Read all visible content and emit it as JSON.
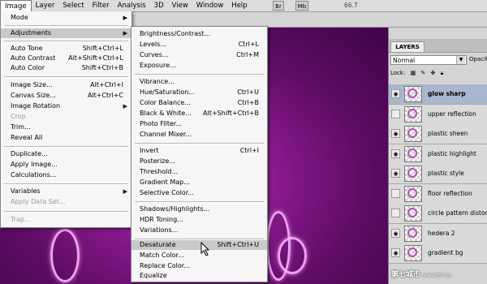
{
  "menubar": {
    "items": [
      "Image",
      "Layer",
      "Select",
      "Filter",
      "Analysis",
      "3D",
      "View",
      "Window",
      "Help"
    ],
    "buttons": [
      "Br",
      "Mb"
    ],
    "zoom": "66.7"
  },
  "image_menu": {
    "items": [
      {
        "label": "Mode",
        "shortcut": "",
        "submenu": true
      },
      {
        "label": "Adjustments",
        "shortcut": "",
        "submenu": true
      },
      {
        "label": "Auto Tone",
        "shortcut": "Shift+Ctrl+L"
      },
      {
        "label": "Auto Contrast",
        "shortcut": "Alt+Shift+Ctrl+L"
      },
      {
        "label": "Auto Color",
        "shortcut": "Shift+Ctrl+B"
      },
      {
        "label": "Image Size...",
        "shortcut": "Alt+Ctrl+I"
      },
      {
        "label": "Canvas Size...",
        "shortcut": "Alt+Ctrl+C"
      },
      {
        "label": "Image Rotation",
        "shortcut": "",
        "submenu": true
      },
      {
        "label": "Crop",
        "shortcut": "",
        "disabled": true
      },
      {
        "label": "Trim...",
        "shortcut": ""
      },
      {
        "label": "Reveal All",
        "shortcut": ""
      },
      {
        "label": "Duplicate...",
        "shortcut": ""
      },
      {
        "label": "Apply Image...",
        "shortcut": ""
      },
      {
        "label": "Calculations...",
        "shortcut": ""
      },
      {
        "label": "Variables",
        "shortcut": "",
        "submenu": true
      },
      {
        "label": "Apply Data Set...",
        "shortcut": "",
        "disabled": true
      },
      {
        "label": "Trap...",
        "shortcut": "",
        "disabled": true
      }
    ]
  },
  "adjustments_menu": {
    "items": [
      {
        "label": "Brightness/Contrast...",
        "shortcut": ""
      },
      {
        "label": "Levels...",
        "shortcut": "Ctrl+L"
      },
      {
        "label": "Curves...",
        "shortcut": "Ctrl+M"
      },
      {
        "label": "Exposure...",
        "shortcut": ""
      },
      {
        "label": "Vibrance...",
        "shortcut": ""
      },
      {
        "label": "Hue/Saturation...",
        "shortcut": "Ctrl+U"
      },
      {
        "label": "Color Balance...",
        "shortcut": "Ctrl+B"
      },
      {
        "label": "Black & White...",
        "shortcut": "Alt+Shift+Ctrl+B"
      },
      {
        "label": "Photo Filter...",
        "shortcut": ""
      },
      {
        "label": "Channel Mixer...",
        "shortcut": ""
      },
      {
        "label": "Invert",
        "shortcut": "Ctrl+I"
      },
      {
        "label": "Posterize...",
        "shortcut": ""
      },
      {
        "label": "Threshold...",
        "shortcut": ""
      },
      {
        "label": "Gradient Map...",
        "shortcut": ""
      },
      {
        "label": "Selective Color...",
        "shortcut": ""
      },
      {
        "label": "Shadows/Highlights...",
        "shortcut": ""
      },
      {
        "label": "HDR Toning...",
        "shortcut": ""
      },
      {
        "label": "Variations...",
        "shortcut": ""
      },
      {
        "label": "Desaturate",
        "shortcut": "Shift+Ctrl+U",
        "highlighted": true
      },
      {
        "label": "Match Color...",
        "shortcut": ""
      },
      {
        "label": "Replace Color...",
        "shortcut": ""
      },
      {
        "label": "Equalize",
        "shortcut": ""
      }
    ]
  },
  "layers_panel": {
    "tab": "LAYERS",
    "blend_mode": "Normal",
    "opacity_label": "Opacity:",
    "lock_label": "Lock:",
    "layers": [
      {
        "name": "glow sharp",
        "selected": true,
        "visible": true
      },
      {
        "name": "upper reflection",
        "visible": false
      },
      {
        "name": "plastic sheen",
        "visible": true
      },
      {
        "name": "plastic highlight",
        "visible": true
      },
      {
        "name": "plastic style",
        "visible": true
      },
      {
        "name": "floor reflection",
        "visible": false
      },
      {
        "name": "circle pattern distort",
        "visible": false
      },
      {
        "name": "hedera 2",
        "visible": true
      },
      {
        "name": "gradient bg",
        "visible": true
      }
    ]
  },
  "watermark": {
    "text": "第七城市",
    "url": "www.th7.cn"
  },
  "colors": {
    "accent": "#3b4f8a",
    "canvas": "#8b1a8f"
  }
}
